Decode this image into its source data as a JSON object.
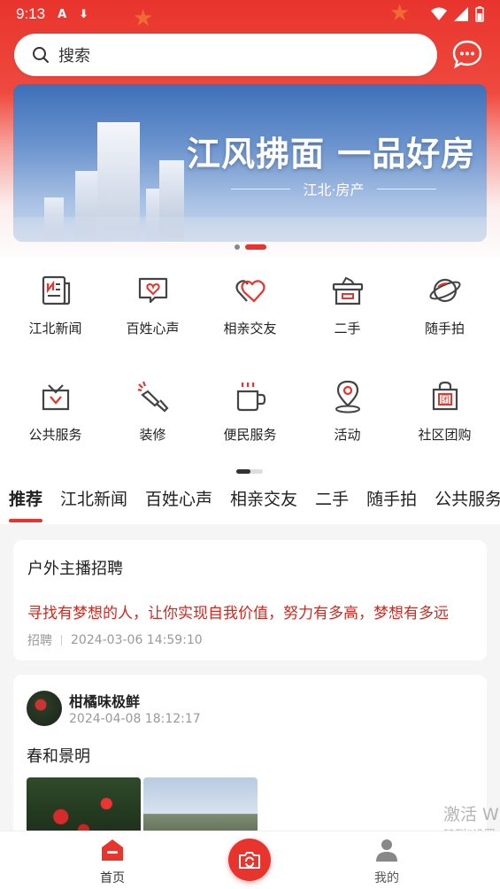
{
  "status": {
    "time": "9:13"
  },
  "search": {
    "placeholder": "搜索"
  },
  "banner": {
    "title": "江风拂面 一品好房",
    "subtitle": "江北·房产"
  },
  "grid": [
    {
      "label": "江北新闻",
      "icon": "newspaper-icon"
    },
    {
      "label": "百姓心声",
      "icon": "heart-message-icon"
    },
    {
      "label": "相亲交友",
      "icon": "double-heart-icon"
    },
    {
      "label": "二手",
      "icon": "box-icon"
    },
    {
      "label": "随手拍",
      "icon": "planet-icon"
    },
    {
      "label": "公共服务",
      "icon": "gift-bag-icon"
    },
    {
      "label": "装修",
      "icon": "paint-brush-icon"
    },
    {
      "label": "便民服务",
      "icon": "cup-icon"
    },
    {
      "label": "活动",
      "icon": "location-pin-icon"
    },
    {
      "label": "社区团购",
      "icon": "shopping-bag-icon"
    }
  ],
  "tabs": [
    "推荐",
    "江北新闻",
    "百姓心声",
    "相亲交友",
    "二手",
    "随手拍",
    "公共服务"
  ],
  "post1": {
    "title": "户外主播招聘",
    "desc": "寻找有梦想的人，让你实现自我价值，努力有多高，梦想有多远",
    "tag": "招聘",
    "time": "2024-03-06 14:59:10"
  },
  "post2": {
    "author": "柑橘味极鲜",
    "time": "2024-04-08 18:12:17",
    "text": "春和景明"
  },
  "watermark": {
    "line1": "激活 W",
    "line2": "转到“设置"
  },
  "nav": {
    "home": "首页",
    "mine": "我的"
  },
  "colors": {
    "accent": "#e8342d"
  }
}
